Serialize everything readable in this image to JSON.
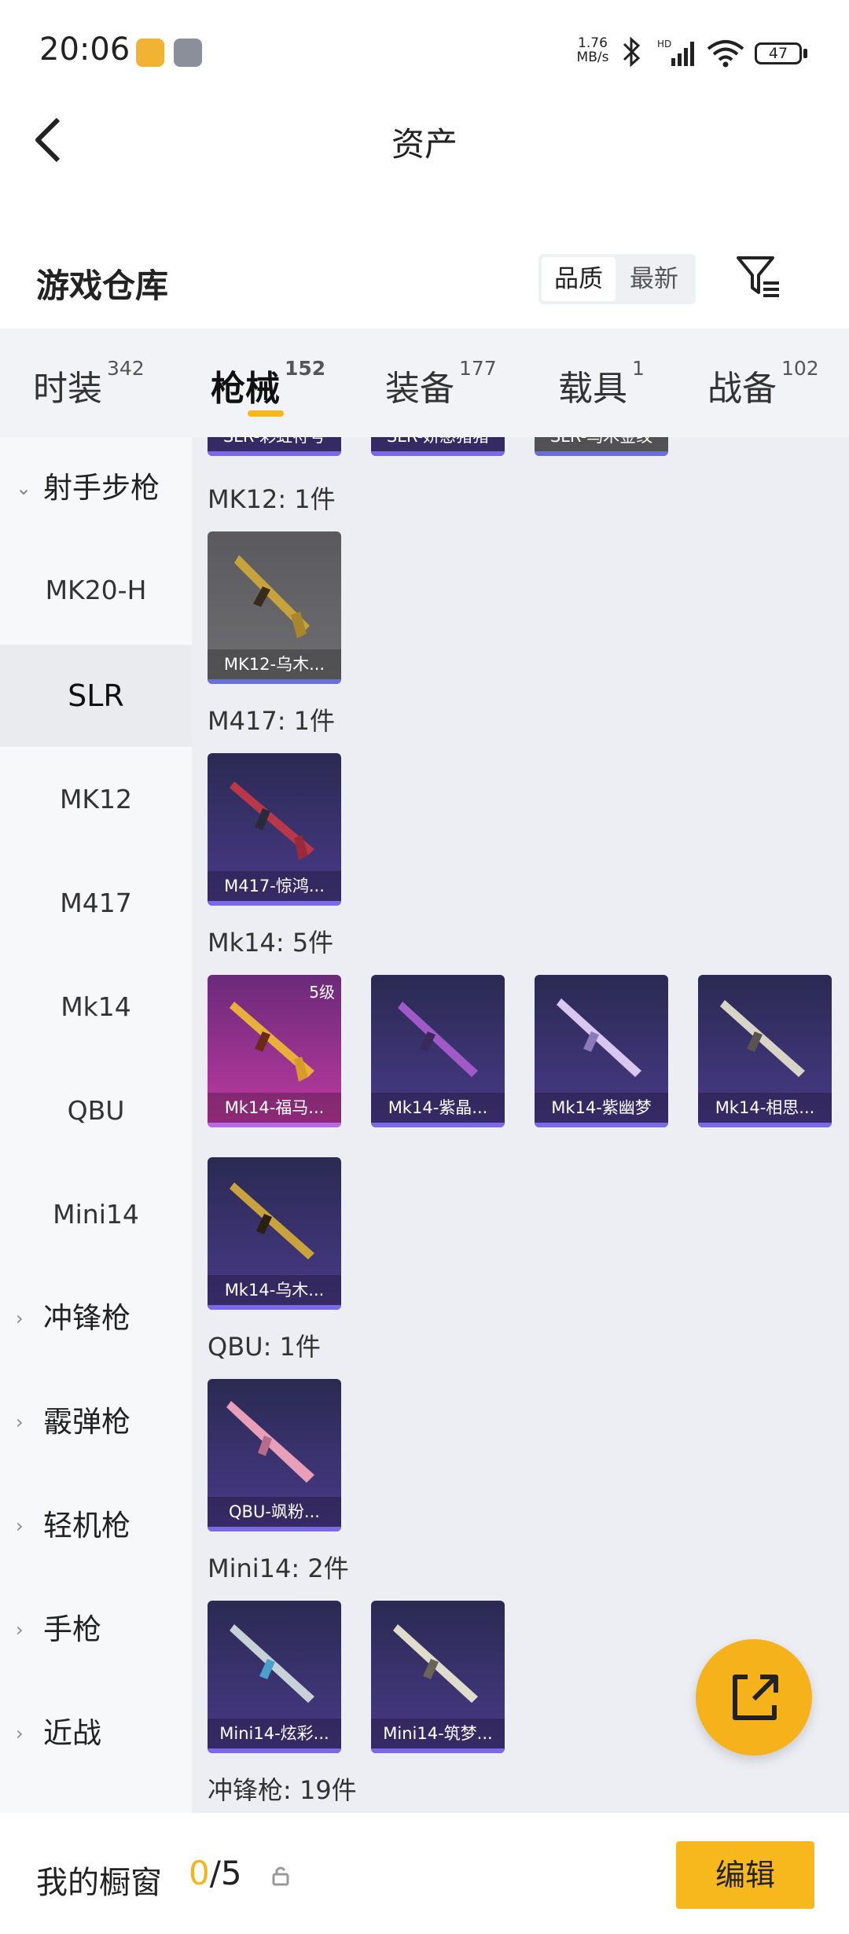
{
  "status_bar": {
    "time": "20:06",
    "net_speed_value": "1.76",
    "net_speed_unit": "MB/s",
    "signal_label": "HD",
    "battery": "47"
  },
  "header": {
    "title": "资产"
  },
  "warehouse": {
    "title": "游戏仓库",
    "sort_quality": "品质",
    "sort_latest": "最新"
  },
  "tabs": [
    {
      "label": "时装",
      "count": "342"
    },
    {
      "label": "枪械",
      "count": "152"
    },
    {
      "label": "装备",
      "count": "177"
    },
    {
      "label": "载具",
      "count": "1"
    },
    {
      "label": "战备",
      "count": "102"
    }
  ],
  "sidebar": {
    "cat_marksman": "射手步枪",
    "items": [
      "MK20-H",
      "SLR",
      "MK12",
      "M417",
      "Mk14",
      "QBU",
      "Mini14"
    ],
    "cats": [
      "冲锋枪",
      "霰弹枪",
      "轻机枪",
      "手枪",
      "近战"
    ]
  },
  "content": {
    "top_cards": [
      "SLR-彩虹符号",
      "SLR-娇憨猪猪",
      "SLR-乌木金纹"
    ],
    "mk12": {
      "heading": "MK12: 1件",
      "cards": [
        "MK12-乌木..."
      ]
    },
    "m417": {
      "heading": "M417: 1件",
      "cards": [
        "M417-惊鸿..."
      ]
    },
    "mk14": {
      "heading": "Mk14: 5件",
      "cards": [
        "Mk14-福马...",
        "Mk14-紫晶...",
        "Mk14-紫幽梦",
        "Mk14-相思...",
        "Mk14-乌木..."
      ],
      "level": "5级"
    },
    "qbu": {
      "heading": "QBU: 1件",
      "cards": [
        "QBU-飒粉..."
      ]
    },
    "mini14": {
      "heading": "Mini14: 2件",
      "cards": [
        "Mini14-炫彩...",
        "Mini14-筑梦..."
      ]
    },
    "smg_heading": "冲锋枪: 19件"
  },
  "bottom": {
    "label": "我的橱窗",
    "count_num": "0",
    "count_total": "/5",
    "edit": "编辑"
  }
}
